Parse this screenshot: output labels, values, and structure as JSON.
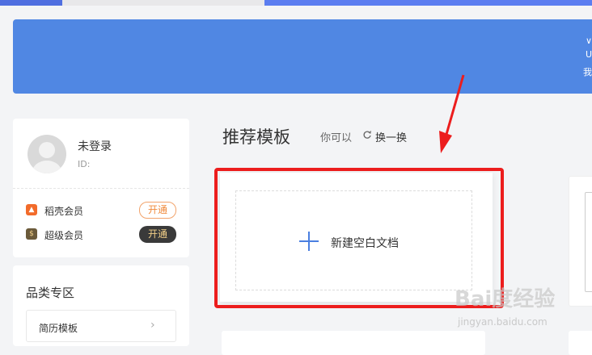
{
  "banner": {
    "line1": "∨",
    "line2": "U",
    "line3": "我"
  },
  "user": {
    "name": "未登录",
    "id_label": "ID:"
  },
  "vip": [
    {
      "label": "稻壳会员",
      "button": "开通",
      "icon": "flame-badge-icon"
    },
    {
      "label": "超级会员",
      "button": "开通",
      "icon": "dollar-badge-icon"
    }
  ],
  "category": {
    "title": "品类专区",
    "items": [
      {
        "label": "简历模板"
      }
    ]
  },
  "recommend": {
    "title": "推荐模板",
    "hint": "你可以",
    "refresh": "换一换"
  },
  "new_doc": {
    "label": "新建空白文档"
  },
  "watermark": {
    "main": "Bai度经验",
    "sub": "jingyan.baidu.com"
  },
  "colors": {
    "accent": "#5087e3",
    "highlight": "#ec1d1d",
    "plus": "#4a7fe0"
  }
}
